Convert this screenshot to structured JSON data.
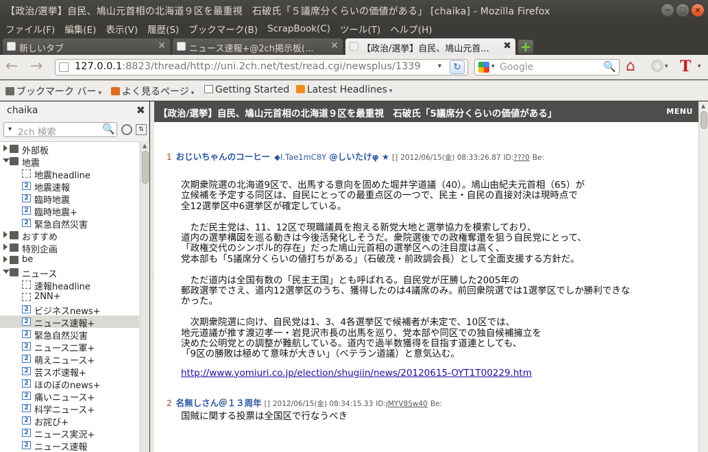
{
  "window": {
    "title": "【政治/選挙】自民、鳩山元首相の北海道９区を最重視　石破氏「５議席分くらいの価値がある」 [chaika] - Mozilla Firefox",
    "btn_min": "−",
    "btn_max": "□",
    "btn_close": "×"
  },
  "menubar": [
    "ファイル(F)",
    "編集(E)",
    "表示(V)",
    "履歴(S)",
    "ブックマーク(B)",
    "ScrapBook(C)",
    "ツール(T)",
    "ヘルプ(H)"
  ],
  "tabs": [
    {
      "label": "新しいタブ",
      "close": "✕"
    },
    {
      "label": "ニュース速報+@2ch掲示板(...",
      "close": "✕"
    },
    {
      "label": "【政治/選挙】自民、鳩山元首...",
      "close": "✖"
    }
  ],
  "newtab_label": "+",
  "nav": {
    "back": "←",
    "forward": "→",
    "url_host": "127.0.0.1",
    "url_rest": ":8823/thread/http://uni.2ch.net/test/read.cgi/newsplus/1339",
    "url_dropdown": "▾",
    "reload": "↻",
    "search_placeholder": "Google",
    "search_icon": "🔍",
    "home_icon": "⌂",
    "ext2": "T"
  },
  "bookmarks": [
    {
      "label": "ブックマーク バー",
      "icon": "folder-icon",
      "dropdown": "▾"
    },
    {
      "label": "よく見るページ",
      "icon": "star-icon",
      "dropdown": "▾"
    },
    {
      "label": "Getting Started",
      "icon": "page-icon",
      "dropdown": ""
    },
    {
      "label": "Latest Headlines",
      "icon": "rss-icon",
      "dropdown": "▾"
    }
  ],
  "sidebar": {
    "title": "chaika",
    "close": "✖",
    "search_placeholder": "2ch 検索",
    "search_dd": "▾",
    "search_icon": "🔍",
    "sort_icon": "⇅",
    "tree": [
      {
        "label": "外部板",
        "type": "folder",
        "level": 0,
        "open": false
      },
      {
        "label": "地震",
        "type": "folder",
        "level": 0,
        "open": true
      },
      {
        "label": "地震headline",
        "type": "dash",
        "level": 1
      },
      {
        "label": "地震速報",
        "type": "board",
        "level": 1
      },
      {
        "label": "臨時地震",
        "type": "board",
        "level": 1
      },
      {
        "label": "臨時地震+",
        "type": "board",
        "level": 1
      },
      {
        "label": "緊急自然災害",
        "type": "board",
        "level": 1
      },
      {
        "label": "おすすめ",
        "type": "folder",
        "level": 0,
        "open": false
      },
      {
        "label": "特別企画",
        "type": "folder",
        "level": 0,
        "open": false
      },
      {
        "label": "be",
        "type": "folder",
        "level": 0,
        "open": false
      },
      {
        "label": "ニュース",
        "type": "folder",
        "level": 0,
        "open": true
      },
      {
        "label": "速報headline",
        "type": "dash",
        "level": 1
      },
      {
        "label": "2NN+",
        "type": "dash",
        "level": 1
      },
      {
        "label": "ビジネスnews+",
        "type": "board",
        "level": 1
      },
      {
        "label": "ニュース速報+",
        "type": "board",
        "level": 1,
        "selected": true
      },
      {
        "label": "緊急自然災害",
        "type": "board",
        "level": 1
      },
      {
        "label": "ニュース二軍+",
        "type": "board",
        "level": 1
      },
      {
        "label": "萌えニュース+",
        "type": "board",
        "level": 1
      },
      {
        "label": "芸スポ速報+",
        "type": "board",
        "level": 1
      },
      {
        "label": "ほのぼのnews+",
        "type": "board",
        "level": 1
      },
      {
        "label": "痛いニュース+",
        "type": "board",
        "level": 1
      },
      {
        "label": "科学ニュース+",
        "type": "board",
        "level": 1
      },
      {
        "label": "お詫び+",
        "type": "board",
        "level": 1
      },
      {
        "label": "ニュース実況+",
        "type": "board",
        "level": 1
      },
      {
        "label": "ニュース速報",
        "type": "board",
        "level": 1
      }
    ]
  },
  "thread": {
    "title": "【政治/選挙】自民、鳩山元首相の北海道９区を最重視　石破氏「5議席分くらいの価値がある」",
    "menu": "MENU",
    "responses": [
      {
        "num": "1",
        "name": "おじいちゃんのコーヒー",
        "trip": "◆I.Tae1mC8Y",
        "trip2": "@しいたけφ ★",
        "mail": "[]",
        "date": "2012/06/15(金) 08:33:26.87",
        "id_label": "ID:",
        "id": "???0",
        "be": "Be:",
        "body": [
          "次期衆院選の北海道9区で、出馬する意向を固めた堀井学道議（40）。鳩山由紀夫元首相（65）が",
          "立候補を予定する同区は、自民にとっての最重点区の一つで、民主・自民の直接対決は現時点で",
          "全12選挙区中6選挙区が確定している。",
          "",
          "　ただ民主党は、11、12区で現職議員を抱える新党大地と選挙協力を模索しており、",
          "道内の選挙構図を巡る動きは今後活発化しそうだ。衆院選後での政権奪還を狙う自民党にとって、",
          "「政権交代のシンボル的存在」だった鳩山元首相の選挙区への注目度は高く、",
          "党本部も「5議席分くらいの値打ちがある」（石破茂・前政調会長）として全面支援する方針だ。",
          "",
          "　ただ道内は全国有数の「民主王国」とも呼ばれる。自民党が圧勝した2005年の",
          "郵政選挙でさえ、道内12選挙区のうち、獲得したのは4議席のみ。前回衆院選では1選挙区でしか勝利できな",
          "かった。",
          "",
          "　次期衆院選に向け、自民党は1、3、4各選挙区で候補者が未定で、10区では、",
          "地元道議が推す渡辺孝一・岩見沢市長の出馬を巡り、党本部や同区での独自候補擁立を",
          "決めた公明党との調整が難航している。道内で過半数獲得を目指す道連としても、",
          "「9区の勝敗は極めて意味が大きい」（ベテラン道議）と意気込む。"
        ],
        "link": "http://www.yomiuri.co.jp/election/shugiin/news/20120615-OYT1T00229.htm"
      },
      {
        "num": "2",
        "name": "名無しさん＠１３周年",
        "mail": "[]",
        "date": "2012/06/15(金) 08:34:15.33",
        "id_label": "ID:",
        "id": "jMYV8Sw40",
        "be": "Be:",
        "body": [
          "国賊に関する投票は全国区で行なうべき"
        ]
      }
    ]
  }
}
